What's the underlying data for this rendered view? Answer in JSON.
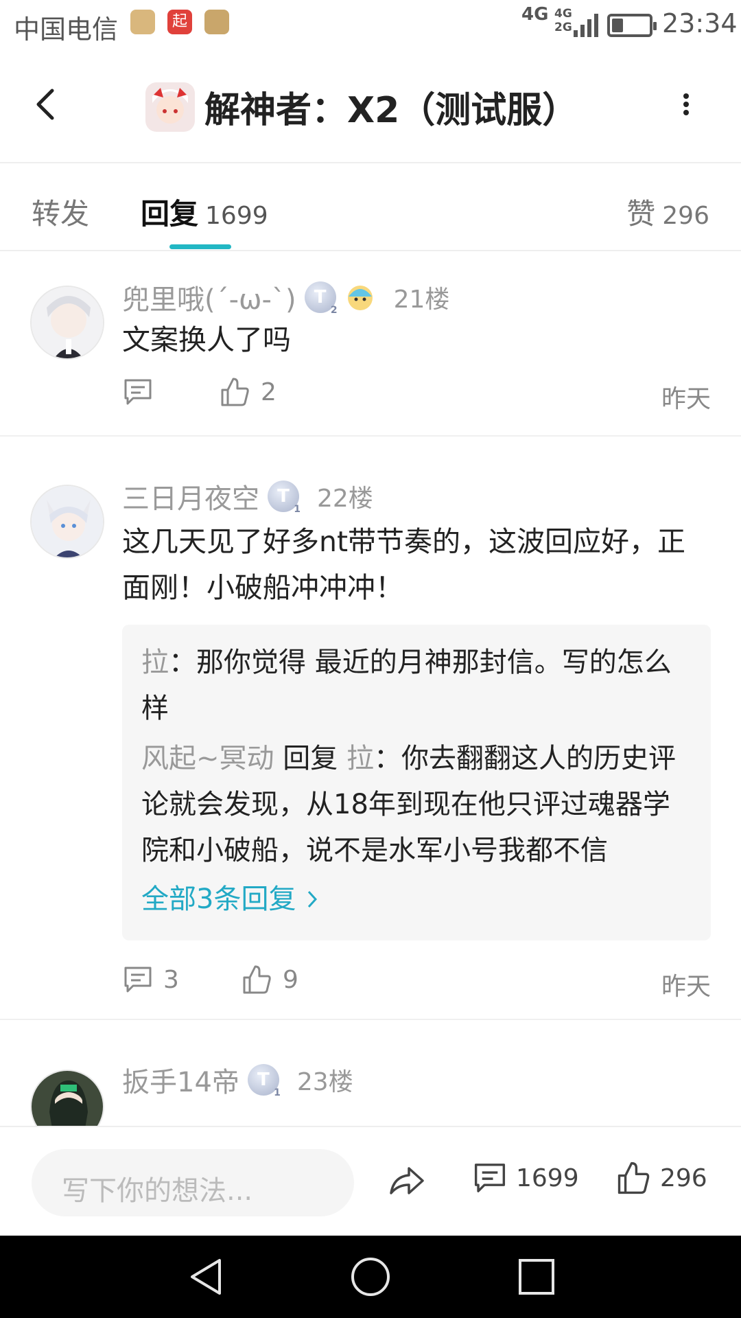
{
  "status_bar": {
    "carrier": "中国电信",
    "network_top": "4G",
    "network_small_top": "4G",
    "network_small_bottom": "2G",
    "time": "23:34"
  },
  "header": {
    "title": "解神者：X2（测试服）"
  },
  "tabs": {
    "repost_label": "转发",
    "reply_label": "回复",
    "reply_count": "1699",
    "like_label": "赞",
    "like_count": "296"
  },
  "comments": [
    {
      "username": "兜里哦(´-ω-`)",
      "floor": "21楼",
      "badge_text": "T",
      "badge_level": "2",
      "text": "文案换人了吗",
      "comment_count": "",
      "like_count": "2",
      "time": "昨天"
    },
    {
      "username": "三日月夜空",
      "floor": "22楼",
      "badge_text": "T",
      "badge_level": "1",
      "text": "这几天见了好多nt带节奏的，这波回应好，正面刚！小破船冲冲冲！",
      "replies": [
        {
          "name": "拉",
          "text": "那你觉得 最近的月神那封信。写的怎么样"
        },
        {
          "name": "风起~冥动",
          "reply_word": "回复",
          "target": "拉",
          "text": "你去翻翻这人的历史评论就会发现，从18年到现在他只评过魂器学院和小破船，说不是水军小号我都不信"
        }
      ],
      "all_replies": "全部3条回复",
      "comment_count": "3",
      "like_count": "9",
      "time": "昨天"
    },
    {
      "username": "扳手14帝",
      "floor": "23楼",
      "badge_text": "T",
      "badge_level": "1"
    }
  ],
  "bottom_bar": {
    "placeholder": "写下你的想法...",
    "comment_count": "1699",
    "like_count": "296"
  }
}
